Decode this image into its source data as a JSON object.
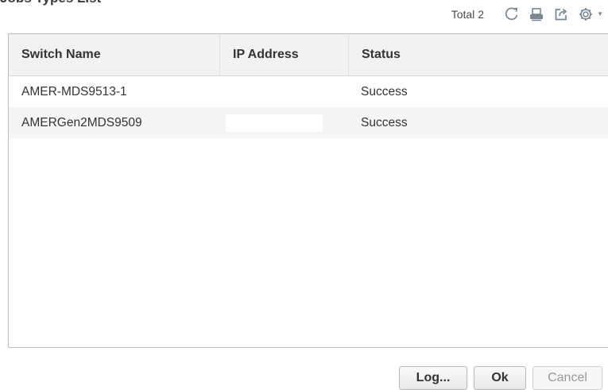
{
  "heading": "Jobs Types List",
  "toolbar": {
    "total_label": "Total",
    "total_count": "2",
    "icons": [
      "refresh-icon",
      "print-icon",
      "export-icon",
      "gear-icon"
    ]
  },
  "table": {
    "columns": [
      "Switch Name",
      "IP Address",
      "Status"
    ],
    "rows": [
      {
        "switch_name": "AMER-MDS9513-1",
        "ip_address": "",
        "status": "Success"
      },
      {
        "switch_name": "AMERGen2MDS9509",
        "ip_address": "",
        "status": "Success"
      }
    ]
  },
  "buttons": {
    "log": "Log...",
    "ok": "Ok",
    "cancel": "Cancel"
  },
  "colors": {
    "icon": "#7a8590",
    "header_bg": "#f2f2f2",
    "alt_row_bg": "#f5f5f5"
  }
}
